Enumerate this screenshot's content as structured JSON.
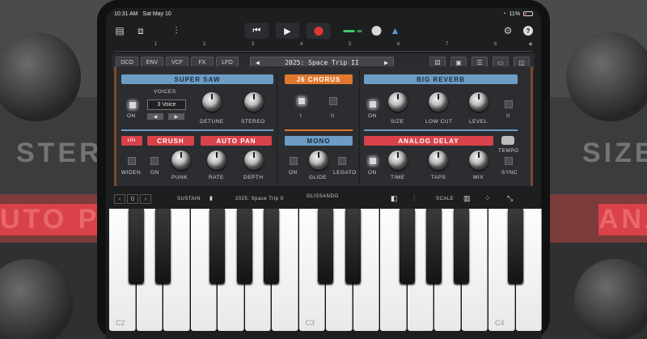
{
  "status": {
    "time": "10:31 AM",
    "date": "Sat May 10",
    "battery": "11%"
  },
  "toolbar": {
    "transport_rewind": "⏮",
    "transport_play": "▶",
    "help": "?"
  },
  "ruler": {
    "marks": [
      "1",
      "2",
      "3",
      "4",
      "5",
      "6",
      "7",
      "8"
    ]
  },
  "tabs": [
    "DCO",
    "ENV",
    "VCF",
    "FX",
    "LFO"
  ],
  "preset": {
    "name": "2025: Space Trip II",
    "prev": "◀",
    "next": "▶"
  },
  "sections": {
    "super_saw": {
      "title": "SUPER SAW",
      "voices_label": "VOICES",
      "voices_value": "3 Voice",
      "on": "ON",
      "detune": "DETUNE",
      "stereo": "STEREO"
    },
    "chorus": {
      "title": "J6 CHORUS",
      "i": "I",
      "ii": "II"
    },
    "reverb": {
      "title": "BIG REVERB",
      "on": "ON",
      "size": "SIZE",
      "low_cut": "LOW CUT",
      "level": "LEVEL",
      "ii": "II"
    },
    "widen": {
      "label": "WIDEN"
    },
    "crush": {
      "title": "CRUSH",
      "on": "ON",
      "punk": "PUNK"
    },
    "autopan": {
      "title": "AUTO PAN",
      "rate": "RATE",
      "depth": "DEPTH"
    },
    "mono": {
      "title": "MONO",
      "on": "ON",
      "glide": "GLIDE",
      "legato": "LEGATO"
    },
    "delay": {
      "title": "ANALOG DELAY",
      "on": "ON",
      "time": "TIME",
      "taps": "TAPS",
      "mix": "MIX",
      "tempo": "TEMPO",
      "sync": "SYNC"
    }
  },
  "kbbar": {
    "prev": "‹",
    "octave": "0",
    "next": "›",
    "sustain": "SUSTAIN",
    "preset": "2025: Space Trip II",
    "glissando": "GLISSANDO",
    "scale": "SCALE"
  },
  "keys": {
    "c2": "C2",
    "c3": "C3",
    "c4": "C4"
  },
  "backdrop": {
    "left_word": "STERE",
    "right_word": "SIZE",
    "left_red": "UTO PAN",
    "right_red": "ANA"
  },
  "colors": {
    "blue": "#6d9cc4",
    "orange": "#e0792f",
    "red": "#d9424a",
    "record": "#e23636"
  }
}
